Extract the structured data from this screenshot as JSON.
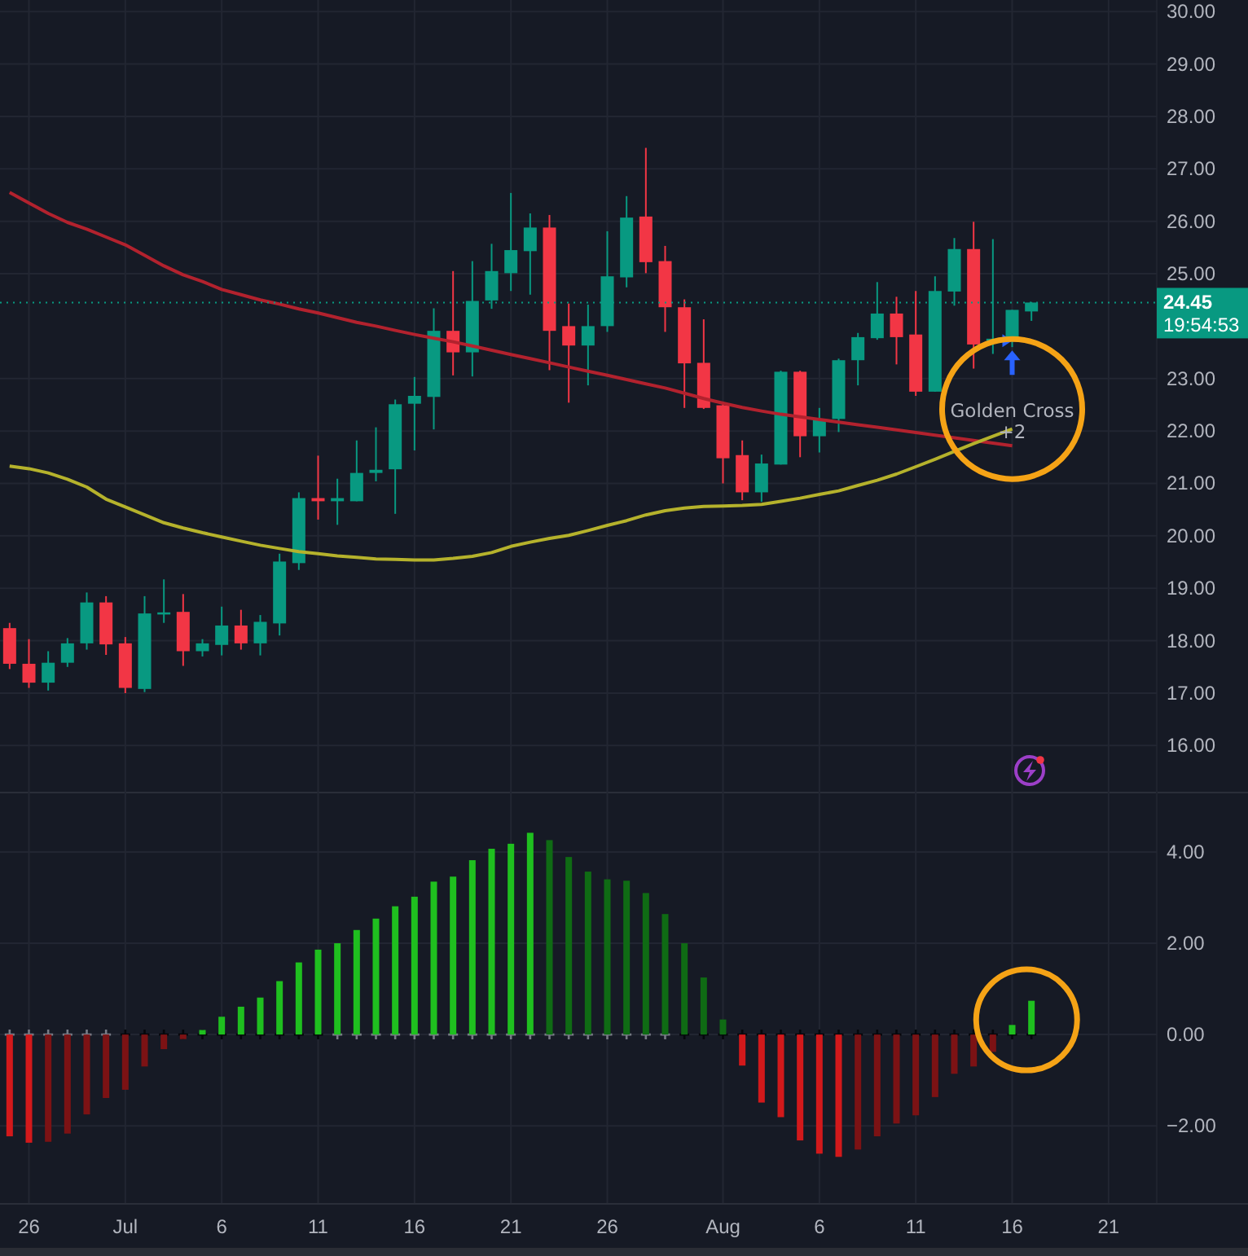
{
  "price_pane": {
    "chart_data": {
      "type": "candlestick",
      "grid": true,
      "ylim": [
        15.12,
        30.22
      ],
      "categories": [
        null,
        null,
        null,
        null,
        null,
        null,
        null,
        null,
        null,
        null,
        null,
        null,
        null,
        null,
        null,
        null,
        null,
        null,
        null,
        null,
        null,
        null,
        null,
        null,
        null,
        null,
        null,
        null,
        null,
        null,
        null,
        null,
        null,
        null,
        null,
        null,
        null,
        null,
        null,
        null,
        null,
        null,
        null,
        null,
        null,
        null,
        null,
        null,
        null,
        null,
        null,
        null,
        null,
        null,
        null,
        null,
        null,
        null,
        null,
        null
      ],
      "yticks": [
        {
          "value": 30,
          "label": "30.00"
        },
        {
          "value": 29,
          "label": "29.00"
        },
        {
          "value": 28,
          "label": "28.00"
        },
        {
          "value": 27,
          "label": "27.00"
        },
        {
          "value": 26,
          "label": "26.00"
        },
        {
          "value": 25,
          "label": "25.00"
        },
        {
          "value": 23,
          "label": "23.00"
        },
        {
          "value": 22,
          "label": "22.00"
        },
        {
          "value": 21,
          "label": "21.00"
        },
        {
          "value": 20,
          "label": "20.00"
        },
        {
          "value": 19,
          "label": "19.00"
        },
        {
          "value": 18,
          "label": "18.00"
        },
        {
          "value": 17,
          "label": "17.00"
        },
        {
          "value": 16,
          "label": "16.00"
        }
      ],
      "ohlc": [
        [
          18.24,
          18.34,
          17.46,
          17.56
        ],
        [
          17.56,
          18.03,
          17.1,
          17.2
        ],
        [
          17.2,
          17.8,
          17.05,
          17.58
        ],
        [
          17.58,
          18.05,
          17.5,
          17.95
        ],
        [
          17.95,
          18.92,
          17.83,
          18.73
        ],
        [
          18.73,
          18.85,
          17.73,
          17.93
        ],
        [
          17.95,
          18.07,
          17.0,
          17.1
        ],
        [
          17.08,
          18.85,
          17.02,
          18.52
        ],
        [
          18.5,
          19.17,
          18.34,
          18.54
        ],
        [
          18.55,
          18.89,
          17.52,
          17.8
        ],
        [
          17.8,
          18.03,
          17.7,
          17.95
        ],
        [
          17.92,
          18.65,
          17.72,
          18.29
        ],
        [
          18.29,
          18.59,
          17.83,
          17.95
        ],
        [
          17.95,
          18.49,
          17.72,
          18.36
        ],
        [
          18.33,
          19.66,
          18.1,
          19.51
        ],
        [
          19.48,
          20.83,
          19.35,
          20.72
        ],
        [
          20.72,
          21.53,
          20.31,
          20.66
        ],
        [
          20.66,
          21.09,
          20.21,
          20.72
        ],
        [
          20.66,
          21.82,
          20.66,
          21.2
        ],
        [
          21.2,
          22.07,
          21.04,
          21.26
        ],
        [
          21.27,
          22.6,
          20.42,
          22.51
        ],
        [
          22.52,
          23.03,
          21.63,
          22.67
        ],
        [
          22.65,
          24.34,
          22.03,
          23.91
        ],
        [
          23.91,
          25.05,
          23.06,
          23.5
        ],
        [
          23.5,
          25.24,
          23.04,
          24.48
        ],
        [
          24.49,
          25.57,
          24.33,
          25.05
        ],
        [
          25.01,
          26.54,
          24.67,
          25.45
        ],
        [
          25.43,
          26.15,
          24.6,
          25.88
        ],
        [
          25.88,
          26.12,
          23.16,
          23.91
        ],
        [
          24.0,
          24.43,
          22.54,
          23.63
        ],
        [
          23.63,
          24.41,
          22.87,
          24.0
        ],
        [
          24.0,
          25.81,
          23.89,
          24.95
        ],
        [
          24.93,
          26.48,
          24.74,
          26.07
        ],
        [
          26.09,
          27.4,
          25.01,
          25.22
        ],
        [
          25.24,
          25.53,
          23.89,
          24.36
        ],
        [
          24.36,
          24.51,
          22.44,
          23.29
        ],
        [
          23.3,
          24.13,
          22.42,
          22.44
        ],
        [
          22.49,
          22.56,
          21.0,
          21.48
        ],
        [
          21.54,
          21.82,
          20.68,
          20.83
        ],
        [
          20.83,
          21.55,
          20.65,
          21.38
        ],
        [
          21.36,
          23.15,
          21.36,
          23.13
        ],
        [
          23.13,
          23.15,
          21.5,
          21.9
        ],
        [
          21.9,
          22.44,
          21.59,
          22.23
        ],
        [
          22.23,
          23.38,
          21.98,
          23.35
        ],
        [
          23.35,
          23.87,
          22.87,
          23.79
        ],
        [
          23.77,
          24.84,
          23.74,
          24.24
        ],
        [
          24.24,
          24.56,
          23.27,
          23.79
        ],
        [
          23.84,
          24.67,
          22.67,
          22.75
        ],
        [
          22.75,
          24.95,
          22.75,
          24.67
        ],
        [
          24.66,
          25.68,
          24.39,
          25.47
        ],
        [
          25.47,
          25.99,
          23.19,
          23.65
        ],
        [
          23.72,
          25.66,
          23.47,
          23.76
        ],
        [
          23.74,
          24.31,
          23.6,
          24.31
        ],
        [
          24.28,
          24.46,
          24.1,
          24.45
        ],
        null,
        null,
        null,
        null,
        null,
        null
      ],
      "series": [
        {
          "type": "line",
          "color": "#b2222e",
          "values": [
            26.55,
            26.35,
            26.15,
            25.98,
            25.85,
            25.7,
            25.55,
            25.35,
            25.15,
            24.98,
            24.85,
            24.7,
            24.6,
            24.5,
            24.42,
            24.33,
            24.25,
            24.16,
            24.07,
            24.0,
            23.92,
            23.84,
            23.77,
            23.7,
            23.62,
            23.54,
            23.46,
            23.38,
            23.3,
            23.22,
            23.14,
            23.06,
            22.98,
            22.9,
            22.82,
            22.72,
            22.62,
            22.53,
            22.45,
            22.38,
            22.32,
            22.27,
            22.22,
            22.17,
            22.12,
            22.07,
            22.02,
            21.97,
            21.92,
            21.87,
            21.82,
            21.77,
            21.72,
            null,
            null,
            null,
            null,
            null,
            null,
            null
          ]
        },
        {
          "type": "line",
          "color": "#b5b22c",
          "values": [
            21.33,
            21.28,
            21.2,
            21.08,
            20.93,
            20.7,
            20.55,
            20.4,
            20.25,
            20.15,
            20.06,
            19.98,
            19.9,
            19.82,
            19.76,
            19.7,
            19.66,
            19.62,
            19.59,
            19.56,
            19.55,
            19.54,
            19.54,
            19.57,
            19.61,
            19.68,
            19.8,
            19.88,
            19.95,
            20.01,
            20.1,
            20.2,
            20.29,
            20.4,
            20.48,
            20.53,
            20.56,
            20.57,
            20.58,
            20.6,
            20.66,
            20.72,
            20.79,
            20.86,
            20.96,
            21.06,
            21.18,
            21.32,
            21.46,
            21.61,
            21.76,
            21.9,
            22.04,
            null,
            null,
            null,
            null,
            null,
            null,
            null
          ]
        }
      ],
      "ref_lines": [
        {
          "axis": "y",
          "value": 24.45,
          "color": "#089981"
        }
      ],
      "annotations": [
        "Golden Cross",
        "+2"
      ]
    },
    "last_price": {
      "price": "24.45",
      "countdown": "19:54:53"
    }
  },
  "indicator_pane": {
    "chart_data": {
      "type": "bar",
      "grid": true,
      "ylim": [
        -3.71,
        5.32
      ],
      "categories": [
        null,
        "26",
        null,
        null,
        null,
        null,
        "Jul",
        null,
        null,
        null,
        null,
        "6",
        null,
        null,
        null,
        null,
        "11",
        null,
        null,
        null,
        null,
        "16",
        null,
        null,
        null,
        null,
        "21",
        null,
        null,
        null,
        null,
        "26",
        null,
        null,
        null,
        null,
        null,
        "Aug",
        null,
        null,
        null,
        null,
        "6",
        null,
        null,
        null,
        null,
        "11",
        null,
        null,
        null,
        null,
        "16",
        null,
        null,
        null,
        null,
        "21",
        null,
        null
      ],
      "yticks": [
        {
          "value": 4,
          "label": "4.00"
        },
        {
          "value": 2,
          "label": "2.00"
        },
        {
          "value": 0,
          "label": "0.00"
        },
        {
          "value": -2,
          "label": "−2.00"
        }
      ],
      "series": [
        {
          "color": "#d2191b",
          "values": [
            -2.23,
            -2.37,
            null,
            null,
            null,
            null,
            null,
            null,
            null,
            null,
            null,
            null,
            null,
            null,
            null,
            null,
            null,
            null,
            null,
            null,
            null,
            null,
            null,
            null,
            null,
            null,
            null,
            null,
            null,
            null,
            null,
            null,
            null,
            null,
            null,
            null,
            null,
            null,
            -0.68,
            -1.49,
            -1.81,
            -2.32,
            -2.61,
            -2.68,
            null,
            null,
            null,
            null,
            null,
            null,
            null,
            null,
            null,
            null,
            null,
            null,
            null,
            null,
            null,
            null
          ]
        },
        {
          "color": "#7c1214",
          "values": [
            null,
            null,
            -2.35,
            -2.17,
            -1.75,
            -1.39,
            -1.21,
            -0.7,
            -0.32,
            -0.1,
            null,
            null,
            null,
            null,
            null,
            null,
            null,
            null,
            null,
            null,
            null,
            null,
            null,
            null,
            null,
            null,
            null,
            null,
            null,
            null,
            null,
            null,
            null,
            null,
            null,
            null,
            null,
            null,
            null,
            null,
            null,
            null,
            null,
            null,
            -2.52,
            -2.23,
            -1.95,
            -1.77,
            -1.37,
            -0.86,
            -0.7,
            -0.38,
            null,
            null,
            null,
            null,
            null,
            null,
            null,
            null
          ]
        },
        {
          "color": "#1fbf1f",
          "values": [
            null,
            null,
            null,
            null,
            null,
            null,
            null,
            null,
            null,
            null,
            0.1,
            0.39,
            0.61,
            0.81,
            1.17,
            1.58,
            1.86,
            2.0,
            2.29,
            2.54,
            2.81,
            3.02,
            3.35,
            3.46,
            3.82,
            4.07,
            4.18,
            4.42,
            null,
            null,
            null,
            null,
            null,
            null,
            null,
            null,
            null,
            null,
            null,
            null,
            null,
            null,
            null,
            null,
            null,
            null,
            null,
            null,
            null,
            null,
            null,
            null,
            0.21,
            0.74,
            null,
            null,
            null,
            null,
            null,
            null
          ]
        },
        {
          "color": "#0f6b14",
          "values": [
            null,
            null,
            null,
            null,
            null,
            null,
            null,
            null,
            null,
            null,
            null,
            null,
            null,
            null,
            null,
            null,
            null,
            null,
            null,
            null,
            null,
            null,
            null,
            null,
            null,
            null,
            null,
            null,
            4.26,
            3.89,
            3.57,
            3.4,
            3.37,
            3.1,
            2.64,
            2.0,
            1.25,
            0.33,
            null,
            null,
            null,
            null,
            null,
            null,
            null,
            null,
            null,
            null,
            null,
            null,
            null,
            null,
            null,
            null,
            null,
            null,
            null,
            null,
            null,
            null
          ]
        }
      ]
    },
    "squeeze": [
      {
        "on": false
      },
      {
        "on": false
      },
      {
        "on": false
      },
      {
        "on": false
      },
      {
        "on": false
      },
      {
        "on": false
      },
      {
        "on": true
      },
      {
        "on": true
      },
      {
        "on": true
      },
      {
        "on": true
      },
      {
        "on": true
      },
      {
        "on": true
      },
      {
        "on": true
      },
      {
        "on": true
      },
      {
        "on": true
      },
      {
        "on": true
      },
      {
        "on": true
      },
      {
        "on": false
      },
      {
        "on": false
      },
      {
        "on": false
      },
      {
        "on": false
      },
      {
        "on": false
      },
      {
        "on": false
      },
      {
        "on": false
      },
      {
        "on": false
      },
      {
        "on": false
      },
      {
        "on": false
      },
      {
        "on": false
      },
      {
        "on": false
      },
      {
        "on": false
      },
      {
        "on": false
      },
      {
        "on": false
      },
      {
        "on": false
      },
      {
        "on": false
      },
      {
        "on": false
      },
      {
        "on": true
      },
      {
        "on": true
      },
      {
        "on": true
      },
      {
        "on": true
      },
      {
        "on": true
      },
      {
        "on": true
      },
      {
        "on": true
      },
      {
        "on": true
      },
      {
        "on": true
      },
      {
        "on": true
      },
      {
        "on": true
      },
      {
        "on": true
      },
      {
        "on": true
      },
      {
        "on": true
      },
      {
        "on": true
      },
      {
        "on": true
      },
      {
        "on": true
      },
      {
        "on": true
      },
      {
        "on": true
      }
    ]
  }
}
